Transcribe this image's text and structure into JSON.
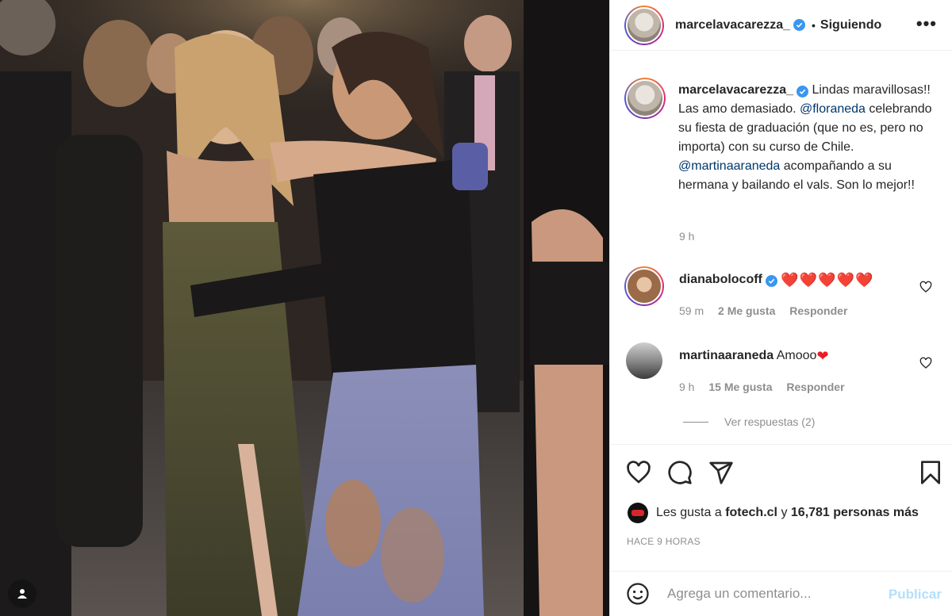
{
  "post": {
    "author": "marcelavacarezza_",
    "separator": "•",
    "follow_status": "Siguiendo",
    "more_label": "•••",
    "caption": {
      "author": "marcelavacarezza_",
      "part1": "Lindas maravillosas!! Las amo demasiado.",
      "mention1": "@floraneda",
      "part2": "celebrando su fiesta de graduación (que no es, pero no importa) con su curso de Chile.",
      "mention2": "@martinaaraneda",
      "part3": "acompañando a su hermana y bailando el vals. Son lo mejor!!",
      "time": "9 h"
    },
    "comments": [
      {
        "user": "dianabolocoff",
        "text": "❤️❤️❤️❤️❤️",
        "time": "59 m",
        "likes": "2 Me gusta",
        "reply": "Responder"
      },
      {
        "user": "martinaaraneda",
        "text": "Amooo",
        "heart": "❤",
        "time": "9 h",
        "likes": "15 Me gusta",
        "reply": "Responder"
      }
    ],
    "view_replies": "Ver respuestas (2)",
    "liked_by_prefix": "Les gusta a",
    "liked_by_user": "fotech.cl",
    "liked_by_mid": "y",
    "liked_by_count": "16,781 personas más",
    "posted_ago": "HACE 9 HORAS",
    "add_comment_placeholder": "Agrega un comentario...",
    "publish_label": "Publicar"
  },
  "colors": {
    "verified": "#3897f0",
    "link": "#00376b",
    "muted": "#8e8e8e",
    "heart": "#ed1c24",
    "publish_disabled": "#b2dffc"
  },
  "icons": [
    "verified-badge-icon",
    "more-options-icon",
    "heart-icon",
    "comment-icon",
    "share-icon",
    "bookmark-icon",
    "emoji-icon",
    "user-tag-icon"
  ]
}
